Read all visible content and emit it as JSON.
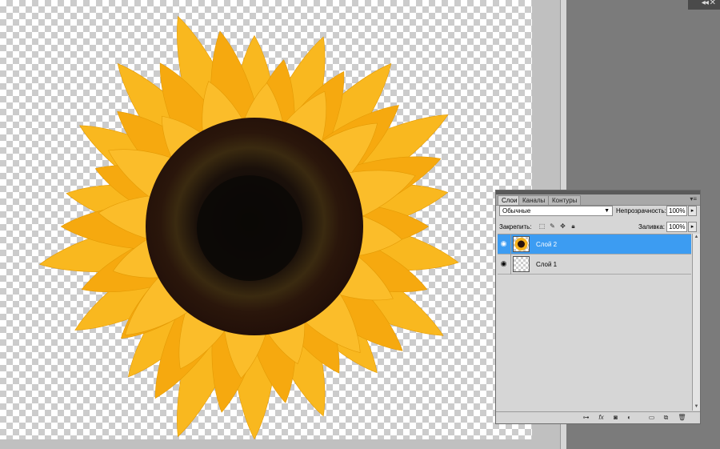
{
  "panel": {
    "tabs": [
      {
        "label": "Слои",
        "active": true
      },
      {
        "label": "Каналы",
        "active": false
      },
      {
        "label": "Контуры",
        "active": false
      }
    ],
    "blend_mode": "Обычные",
    "opacity_label": "Непрозрачность:",
    "opacity_value": "100%",
    "lock_label": "Закрепить:",
    "fill_label": "Заливка:",
    "fill_value": "100%",
    "layers": [
      {
        "name": "Слой 2",
        "selected": true,
        "visible": true,
        "thumb": "sunflower"
      },
      {
        "name": "Слой 1",
        "selected": false,
        "visible": true,
        "thumb": "transparent"
      }
    ],
    "footer_icons": [
      "link-icon",
      "fx-icon",
      "mask-icon",
      "adjustment-icon",
      "group-icon",
      "new-layer-icon",
      "trash-icon"
    ],
    "lock_icons": [
      "lock-transparency-icon",
      "lock-pixels-icon",
      "lock-position-icon",
      "lock-all-icon"
    ]
  },
  "colors": {
    "selection": "#3c9cf2",
    "panel_bg": "#d6d6d6",
    "workspace": "#7b7b7b",
    "petal": "#f7b21b",
    "center": "#2a130a"
  }
}
